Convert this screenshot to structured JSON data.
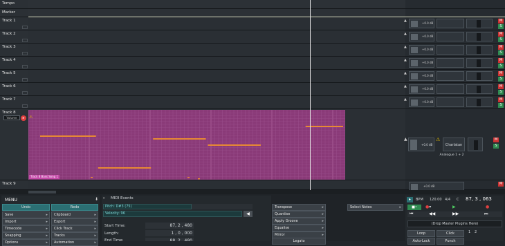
{
  "tracks": {
    "tempo_label": "Tempo",
    "marker_label": "Marker",
    "items": [
      {
        "label": "Track 1"
      },
      {
        "label": "Track 2"
      },
      {
        "label": "Track 3"
      },
      {
        "label": "Track 4"
      },
      {
        "label": "Track 5"
      },
      {
        "label": "Track 6"
      },
      {
        "label": "Track 7"
      },
      {
        "label": "Track 8"
      },
      {
        "label": "Track 9"
      }
    ],
    "clip_name": "Track 8 Bass Song 1",
    "track8_plugin_label": "Charlatan",
    "track8_output": "Analogue 1 + 2",
    "volume_readout": "+0.0 dB",
    "input_chip": "Volume",
    "mute": "M",
    "solo": "S"
  },
  "menu": {
    "title": "MENU",
    "undo": "Undo",
    "redo": "Redo",
    "left": [
      "Save",
      "Import",
      "Timecode",
      "Snapping",
      "Options"
    ],
    "right": [
      "Clipboard",
      "Export",
      "Click Track",
      "Tracks",
      "Automation"
    ]
  },
  "midi": {
    "title": "MIDI Events",
    "pitch": "Pitch: D#3 (75)",
    "velocity": "Velocity: 96",
    "start_label": "Start Time:",
    "start_value": "87, 2 , 480",
    "length_label": "Length:",
    "length_value": "1 , 0 , 000",
    "end_label": "End Time:",
    "end_value": "88, 2 , 480"
  },
  "edit": {
    "items": [
      "Transpose",
      "Quantise",
      "Apply Groove",
      "Equalise",
      "Mirror"
    ],
    "legato": "Legato",
    "select_notes": "Select Notes"
  },
  "transport": {
    "bpm_label": "BPM",
    "bpm": "120.00",
    "sig": "4/4",
    "key": "C",
    "position": "87, 3 , 063",
    "master_drop": "(Drop Master Plugins Here)",
    "loop": "Loop",
    "click": "Click",
    "auto_lock": "Auto-Lock",
    "punch": "Punch",
    "seg1": "1",
    "seg2": "2"
  },
  "colors": {
    "clip": "#8a3a78",
    "note": "#e88a33",
    "accent": "#2b6f73"
  },
  "notes": [
    {
      "start": 0.0,
      "dur": 0.19,
      "pitch_row": 3
    },
    {
      "start": 0.19,
      "dur": 0.18,
      "pitch_row": 8
    },
    {
      "start": 0.37,
      "dur": 0.18,
      "pitch_row": 4
    },
    {
      "start": 0.55,
      "dur": 0.18,
      "pitch_row": 6
    },
    {
      "start": 0.87,
      "dur": 0.13,
      "pitch_row": 1
    }
  ]
}
